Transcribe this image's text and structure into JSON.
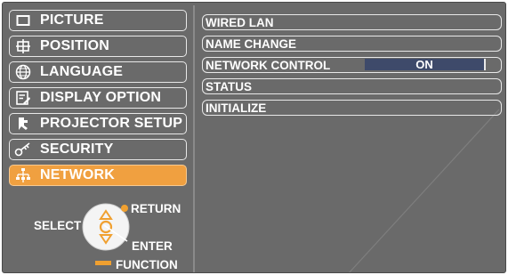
{
  "menu": [
    {
      "label": "PICTURE",
      "icon": "picture-icon",
      "active": false
    },
    {
      "label": "POSITION",
      "icon": "position-icon",
      "active": false
    },
    {
      "label": "LANGUAGE",
      "icon": "language-icon",
      "active": false
    },
    {
      "label": "DISPLAY OPTION",
      "icon": "display-option-icon",
      "active": false
    },
    {
      "label": "PROJECTOR SETUP",
      "icon": "projector-setup-icon",
      "active": false
    },
    {
      "label": "SECURITY",
      "icon": "security-key-icon",
      "active": false
    },
    {
      "label": "NETWORK",
      "icon": "network-icon",
      "active": true
    }
  ],
  "submenu": [
    {
      "label": "WIRED LAN"
    },
    {
      "label": "NAME CHANGE"
    },
    {
      "label": "NETWORK CONTROL",
      "value": "ON"
    },
    {
      "label": "STATUS"
    },
    {
      "label": "INITIALIZE"
    }
  ],
  "nav": {
    "select": "SELECT",
    "return": "RETURN",
    "enter": "ENTER",
    "function": "FUNCTION"
  },
  "colors": {
    "background": "#6a6a6a",
    "active": "#f0a040",
    "value_box": "#3e4a6a",
    "accent_orange": "#f0a030"
  }
}
